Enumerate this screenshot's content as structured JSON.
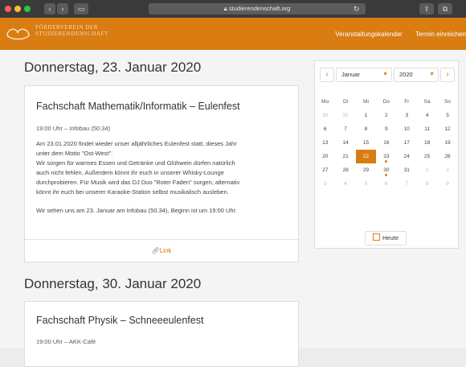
{
  "browser": {
    "url": "studierendenschaft.org",
    "back_icon": "chevron-left-icon",
    "forward_icon": "chevron-right-icon"
  },
  "site": {
    "logo_line1": "FÖRDERVEREIN DER",
    "logo_line2": "STUDIERENDENSCHAFT",
    "nav": [
      "Veranstaltungskalender",
      "Termin einreichen"
    ],
    "accent_color": "#d97c12"
  },
  "events": [
    {
      "date_heading": "Donnerstag, 23. Januar 2020",
      "title": "Fachschaft Mathematik/Informatik – Eulenfest",
      "meta": "19:00 Uhr – Infobau (50.34)",
      "body": [
        "Am 23.01.2020 findet wieder unser alljährliches Eulenfest statt, dieses Jahr",
        "unter dem Motto \"Ost-West\".",
        "Wir sorgen für warmes Essen und Getränke und Glühwein dürfen natürlich",
        "auch nicht fehlen. Außerdem könnt ihr euch in unserer Whisky-Lounge",
        "durchprobieren. Für Musik wird das DJ Duo \"Roter Faden\" sorgen, alternativ",
        "könnt ihr euch bei unserer Karaoke-Station selbst musikalisch ausleben.",
        "",
        "Wir sehen uns am 23. Januar am Infobau (50.34), Beginn ist um 19:00 Uhr."
      ],
      "link_label": "Link"
    },
    {
      "date_heading": "Donnerstag, 30. Januar 2020",
      "title": "Fachschaft Physik – Schneeeulenfest",
      "meta": "19:00 Uhr – AKK-Café"
    }
  ],
  "calendar": {
    "month": "Januar",
    "year": "2020",
    "weekdays": [
      "Mo",
      "Di",
      "Mi",
      "Do",
      "Fr",
      "Sa",
      "So"
    ],
    "weeks": [
      [
        "30",
        "31",
        "1",
        "2",
        "3",
        "4",
        "5"
      ],
      [
        "6",
        "7",
        "8",
        "9",
        "10",
        "11",
        "12"
      ],
      [
        "13",
        "14",
        "15",
        "16",
        "17",
        "18",
        "19"
      ],
      [
        "20",
        "21",
        "22",
        "23",
        "24",
        "25",
        "26"
      ],
      [
        "27",
        "28",
        "29",
        "30",
        "31",
        "1",
        "2"
      ],
      [
        "3",
        "4",
        "5",
        "6",
        "7",
        "8",
        "9"
      ]
    ],
    "today_label": "Heute"
  }
}
